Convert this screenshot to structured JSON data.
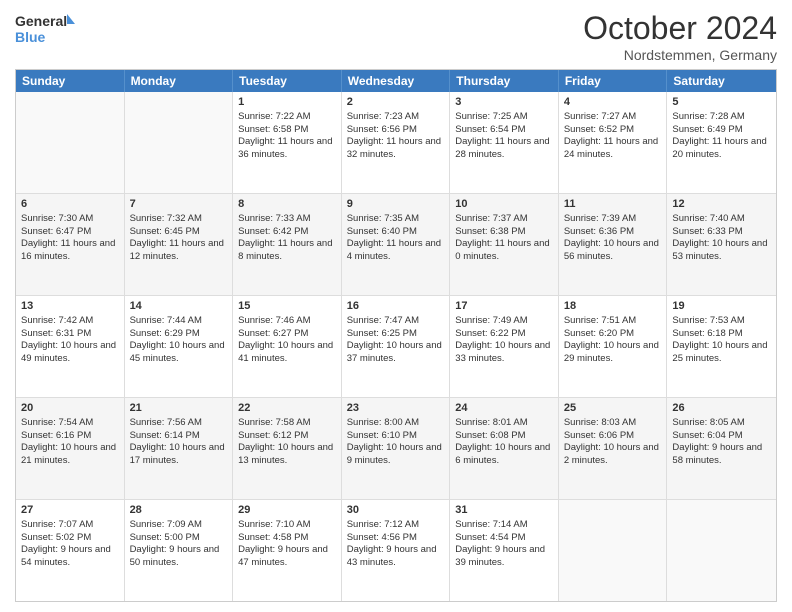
{
  "header": {
    "logo_line1": "General",
    "logo_line2": "Blue",
    "month": "October 2024",
    "location": "Nordstemmen, Germany"
  },
  "weekdays": [
    "Sunday",
    "Monday",
    "Tuesday",
    "Wednesday",
    "Thursday",
    "Friday",
    "Saturday"
  ],
  "weeks": [
    [
      {
        "day": "",
        "sunrise": "",
        "sunset": "",
        "daylight": ""
      },
      {
        "day": "",
        "sunrise": "",
        "sunset": "",
        "daylight": ""
      },
      {
        "day": "1",
        "sunrise": "Sunrise: 7:22 AM",
        "sunset": "Sunset: 6:58 PM",
        "daylight": "Daylight: 11 hours and 36 minutes."
      },
      {
        "day": "2",
        "sunrise": "Sunrise: 7:23 AM",
        "sunset": "Sunset: 6:56 PM",
        "daylight": "Daylight: 11 hours and 32 minutes."
      },
      {
        "day": "3",
        "sunrise": "Sunrise: 7:25 AM",
        "sunset": "Sunset: 6:54 PM",
        "daylight": "Daylight: 11 hours and 28 minutes."
      },
      {
        "day": "4",
        "sunrise": "Sunrise: 7:27 AM",
        "sunset": "Sunset: 6:52 PM",
        "daylight": "Daylight: 11 hours and 24 minutes."
      },
      {
        "day": "5",
        "sunrise": "Sunrise: 7:28 AM",
        "sunset": "Sunset: 6:49 PM",
        "daylight": "Daylight: 11 hours and 20 minutes."
      }
    ],
    [
      {
        "day": "6",
        "sunrise": "Sunrise: 7:30 AM",
        "sunset": "Sunset: 6:47 PM",
        "daylight": "Daylight: 11 hours and 16 minutes."
      },
      {
        "day": "7",
        "sunrise": "Sunrise: 7:32 AM",
        "sunset": "Sunset: 6:45 PM",
        "daylight": "Daylight: 11 hours and 12 minutes."
      },
      {
        "day": "8",
        "sunrise": "Sunrise: 7:33 AM",
        "sunset": "Sunset: 6:42 PM",
        "daylight": "Daylight: 11 hours and 8 minutes."
      },
      {
        "day": "9",
        "sunrise": "Sunrise: 7:35 AM",
        "sunset": "Sunset: 6:40 PM",
        "daylight": "Daylight: 11 hours and 4 minutes."
      },
      {
        "day": "10",
        "sunrise": "Sunrise: 7:37 AM",
        "sunset": "Sunset: 6:38 PM",
        "daylight": "Daylight: 11 hours and 0 minutes."
      },
      {
        "day": "11",
        "sunrise": "Sunrise: 7:39 AM",
        "sunset": "Sunset: 6:36 PM",
        "daylight": "Daylight: 10 hours and 56 minutes."
      },
      {
        "day": "12",
        "sunrise": "Sunrise: 7:40 AM",
        "sunset": "Sunset: 6:33 PM",
        "daylight": "Daylight: 10 hours and 53 minutes."
      }
    ],
    [
      {
        "day": "13",
        "sunrise": "Sunrise: 7:42 AM",
        "sunset": "Sunset: 6:31 PM",
        "daylight": "Daylight: 10 hours and 49 minutes."
      },
      {
        "day": "14",
        "sunrise": "Sunrise: 7:44 AM",
        "sunset": "Sunset: 6:29 PM",
        "daylight": "Daylight: 10 hours and 45 minutes."
      },
      {
        "day": "15",
        "sunrise": "Sunrise: 7:46 AM",
        "sunset": "Sunset: 6:27 PM",
        "daylight": "Daylight: 10 hours and 41 minutes."
      },
      {
        "day": "16",
        "sunrise": "Sunrise: 7:47 AM",
        "sunset": "Sunset: 6:25 PM",
        "daylight": "Daylight: 10 hours and 37 minutes."
      },
      {
        "day": "17",
        "sunrise": "Sunrise: 7:49 AM",
        "sunset": "Sunset: 6:22 PM",
        "daylight": "Daylight: 10 hours and 33 minutes."
      },
      {
        "day": "18",
        "sunrise": "Sunrise: 7:51 AM",
        "sunset": "Sunset: 6:20 PM",
        "daylight": "Daylight: 10 hours and 29 minutes."
      },
      {
        "day": "19",
        "sunrise": "Sunrise: 7:53 AM",
        "sunset": "Sunset: 6:18 PM",
        "daylight": "Daylight: 10 hours and 25 minutes."
      }
    ],
    [
      {
        "day": "20",
        "sunrise": "Sunrise: 7:54 AM",
        "sunset": "Sunset: 6:16 PM",
        "daylight": "Daylight: 10 hours and 21 minutes."
      },
      {
        "day": "21",
        "sunrise": "Sunrise: 7:56 AM",
        "sunset": "Sunset: 6:14 PM",
        "daylight": "Daylight: 10 hours and 17 minutes."
      },
      {
        "day": "22",
        "sunrise": "Sunrise: 7:58 AM",
        "sunset": "Sunset: 6:12 PM",
        "daylight": "Daylight: 10 hours and 13 minutes."
      },
      {
        "day": "23",
        "sunrise": "Sunrise: 8:00 AM",
        "sunset": "Sunset: 6:10 PM",
        "daylight": "Daylight: 10 hours and 9 minutes."
      },
      {
        "day": "24",
        "sunrise": "Sunrise: 8:01 AM",
        "sunset": "Sunset: 6:08 PM",
        "daylight": "Daylight: 10 hours and 6 minutes."
      },
      {
        "day": "25",
        "sunrise": "Sunrise: 8:03 AM",
        "sunset": "Sunset: 6:06 PM",
        "daylight": "Daylight: 10 hours and 2 minutes."
      },
      {
        "day": "26",
        "sunrise": "Sunrise: 8:05 AM",
        "sunset": "Sunset: 6:04 PM",
        "daylight": "Daylight: 9 hours and 58 minutes."
      }
    ],
    [
      {
        "day": "27",
        "sunrise": "Sunrise: 7:07 AM",
        "sunset": "Sunset: 5:02 PM",
        "daylight": "Daylight: 9 hours and 54 minutes."
      },
      {
        "day": "28",
        "sunrise": "Sunrise: 7:09 AM",
        "sunset": "Sunset: 5:00 PM",
        "daylight": "Daylight: 9 hours and 50 minutes."
      },
      {
        "day": "29",
        "sunrise": "Sunrise: 7:10 AM",
        "sunset": "Sunset: 4:58 PM",
        "daylight": "Daylight: 9 hours and 47 minutes."
      },
      {
        "day": "30",
        "sunrise": "Sunrise: 7:12 AM",
        "sunset": "Sunset: 4:56 PM",
        "daylight": "Daylight: 9 hours and 43 minutes."
      },
      {
        "day": "31",
        "sunrise": "Sunrise: 7:14 AM",
        "sunset": "Sunset: 4:54 PM",
        "daylight": "Daylight: 9 hours and 39 minutes."
      },
      {
        "day": "",
        "sunrise": "",
        "sunset": "",
        "daylight": ""
      },
      {
        "day": "",
        "sunrise": "",
        "sunset": "",
        "daylight": ""
      }
    ]
  ]
}
